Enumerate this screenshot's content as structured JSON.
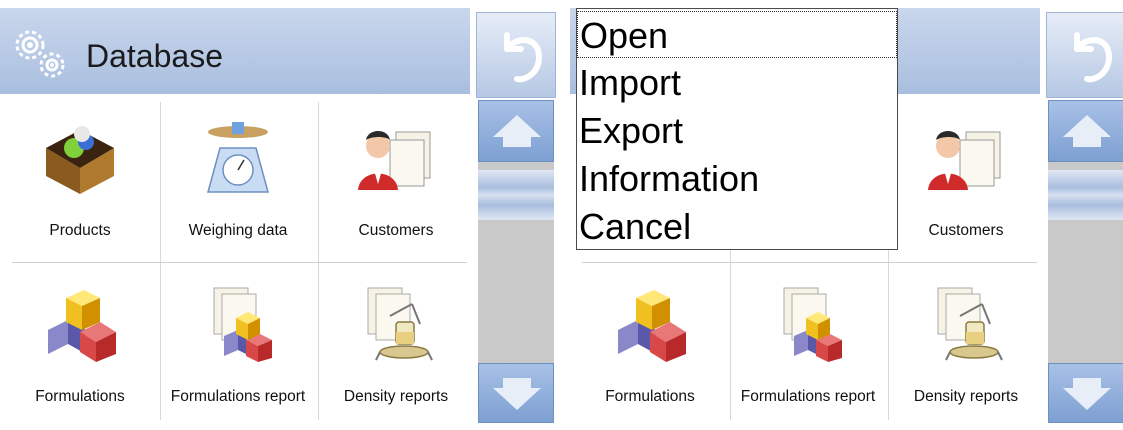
{
  "header": {
    "title": "Database"
  },
  "tiles": {
    "products": "Products",
    "weighing_data": "Weighing data",
    "customers": "Customers",
    "formulations": "Formulations",
    "formulations_report": "Formulations report",
    "density_reports": "Density reports"
  },
  "menu": {
    "items": [
      "Open",
      "Import",
      "Export",
      "Information",
      "Cancel"
    ],
    "selected_index": 0
  },
  "icons": {
    "header": "gears-icon",
    "back": "undo-arrow-icon",
    "up": "arrow-up-icon",
    "down": "arrow-down-icon",
    "products": "product-box-icon",
    "weighing_data": "weighing-scale-icon",
    "customers": "customer-card-icon",
    "formulations": "formulation-cubes-icon",
    "formulations_report": "formulation-report-icon",
    "density_reports": "density-report-icon"
  },
  "colors": {
    "header_bg": "#b9cbe6",
    "nav_button": "#8fadd9",
    "scroll_track": "#c9c9c9",
    "menu_border": "#4a4a4a"
  }
}
